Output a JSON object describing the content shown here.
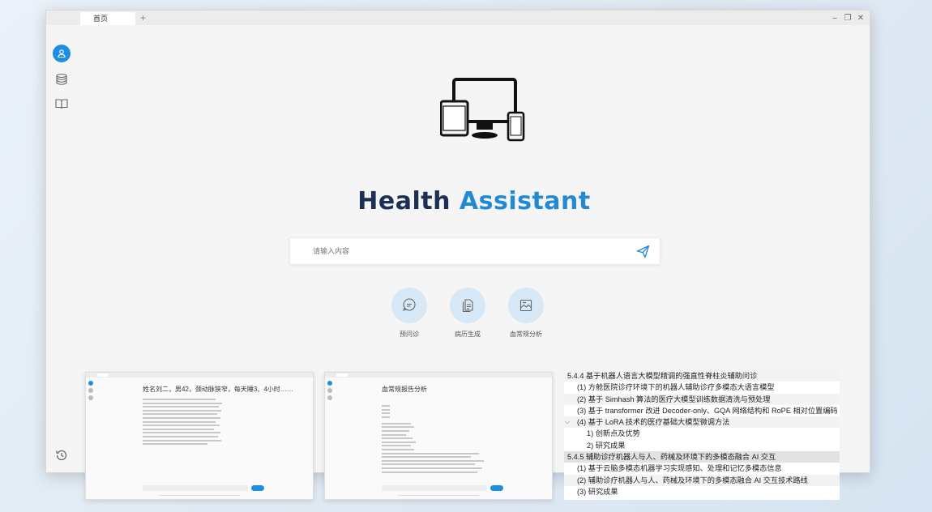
{
  "window": {
    "tab_label": "首页",
    "tab_add": "+",
    "controls": {
      "minimize": "–",
      "restore": "❐",
      "close": "✕"
    }
  },
  "sidebar": {
    "items": [
      {
        "name": "user",
        "icon": "user-icon",
        "active": true
      },
      {
        "name": "database",
        "icon": "database-icon",
        "active": false
      },
      {
        "name": "book",
        "icon": "book-icon",
        "active": false
      }
    ],
    "bottom_icon": "history-icon"
  },
  "brand": {
    "word1": "Health",
    "word2": "Assistant",
    "color1": "#1d2f52",
    "color2": "#2489d4"
  },
  "search": {
    "placeholder": "请输入内容",
    "value": ""
  },
  "quick_actions": [
    {
      "label": "预问诊",
      "icon": "chat-icon"
    },
    {
      "label": "病历生成",
      "icon": "document-icon"
    },
    {
      "label": "血常规分析",
      "icon": "image-analysis-icon"
    }
  ],
  "thumbnails": [
    {
      "title": "姓名刘二，男42，颈动脉狭窄，每天睡3、4小时……"
    },
    {
      "title": "血常规报告分析"
    }
  ],
  "outline": [
    {
      "text": "5.4.4 基于机器人语言大模型精调的强直性脊柱炎辅助问诊",
      "level": 0,
      "style": "alt"
    },
    {
      "text": "(1) 方舱医院诊疗环境下的机器人辅助诊疗多模态大语言模型",
      "level": 1,
      "style": ""
    },
    {
      "text": "(2) 基于 Simhash 算法的医疗大模型训练数据清洗与预处理",
      "level": 1,
      "style": "alt"
    },
    {
      "text": "(3) 基于 transformer 改进 Decoder-only、GQA 网络结构和 RoPE 相对位置编码",
      "level": 1,
      "style": ""
    },
    {
      "text": "(4) 基于 LoRA 技术的医疗基础大模型微调方法",
      "level": 1,
      "style": "alt",
      "chevron": "⌵"
    },
    {
      "text": "1) 创新点及优势",
      "level": 2,
      "style": ""
    },
    {
      "text": "2) 研究成果",
      "level": 2,
      "style": ""
    },
    {
      "text": "5.4.5 辅助诊疗机器人与人、药械及环境下的多模态融合 AI 交互",
      "level": 0,
      "style": "sel"
    },
    {
      "text": "(1) 基于云脑多模态机器学习实现感知、处理和记忆多模态信息",
      "level": 1,
      "style": ""
    },
    {
      "text": "(2) 辅助诊疗机器人与人、药械及环境下的多模态融合 AI 交互技术路线",
      "level": 1,
      "style": "alt"
    },
    {
      "text": "(3) 研究成果",
      "level": 1,
      "style": ""
    }
  ]
}
